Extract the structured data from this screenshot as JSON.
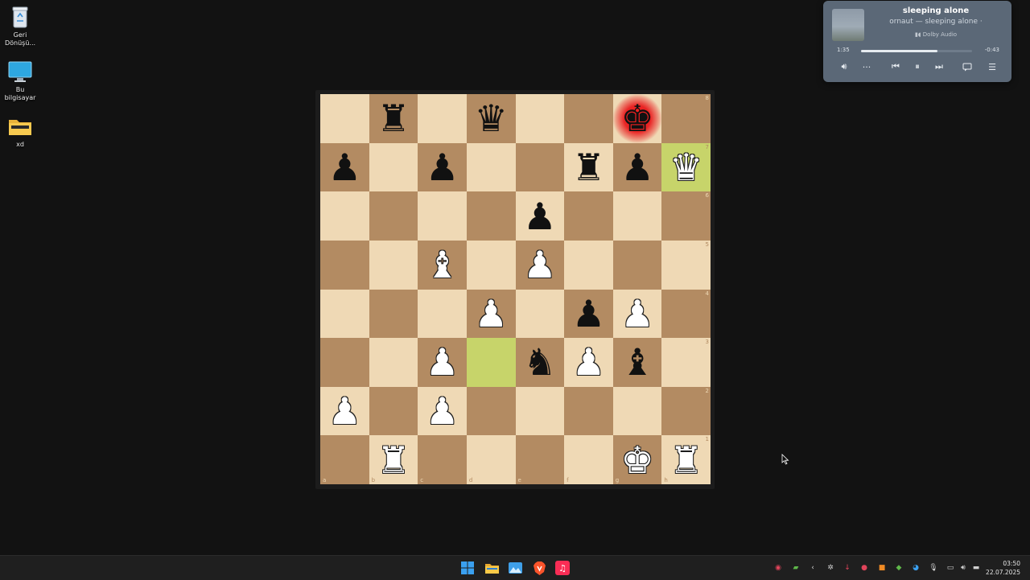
{
  "desktop": {
    "icons": [
      {
        "label": "Geri Dönüşü...",
        "icon": "recycle-bin-icon"
      },
      {
        "label": "Bu bilgisayar",
        "icon": "computer-icon"
      },
      {
        "label": "xd",
        "icon": "folder-icon"
      }
    ]
  },
  "board": {
    "orientation": "white-bottom",
    "files": [
      "a",
      "b",
      "c",
      "d",
      "e",
      "f",
      "g",
      "h"
    ],
    "ranks": [
      "8",
      "7",
      "6",
      "5",
      "4",
      "3",
      "2",
      "1"
    ],
    "fen_rows": [
      ". r . q . . k .",
      "p . p . . r p Q",
      ". . . . p . . .",
      ". . B . P . . .",
      ". . . P . p P .",
      ". . P . n P b .",
      "P . P . . . . .",
      ". R . . . . K R"
    ],
    "highlights": [
      "h7",
      "d3"
    ],
    "check_square": "g8",
    "colors": {
      "light": "#efd9b5",
      "dark": "#b38b62",
      "highlight": "#b3c95d",
      "check": "#e82424"
    }
  },
  "media": {
    "title": "sleeping alone",
    "artist": "ornaut — sleeping alone ·",
    "badge": "Dolby Audio",
    "elapsed": "1:35",
    "remaining": "-0:43",
    "progress": 0.69,
    "controls": [
      "volume-icon",
      "more-icon",
      "previous-icon",
      "pause-icon",
      "next-icon",
      "lyrics-icon",
      "queue-icon"
    ]
  },
  "taskbar": {
    "apps": [
      "start-icon",
      "file-explorer-icon",
      "photos-icon",
      "brave-browser-icon",
      "apple-music-icon"
    ],
    "tray": [
      "tray-app-1-icon",
      "tray-app-2-icon",
      "tray-chevron-icon",
      "tray-app-3-icon",
      "tray-app-4-icon",
      "tray-app-5-icon",
      "tray-app-6-icon",
      "tray-app-7-icon",
      "tray-app-8-icon",
      "microphone-icon",
      "network-icon",
      "speaker-icon",
      "battery-icon"
    ],
    "time": "03:50",
    "date": "22.07.2025"
  }
}
